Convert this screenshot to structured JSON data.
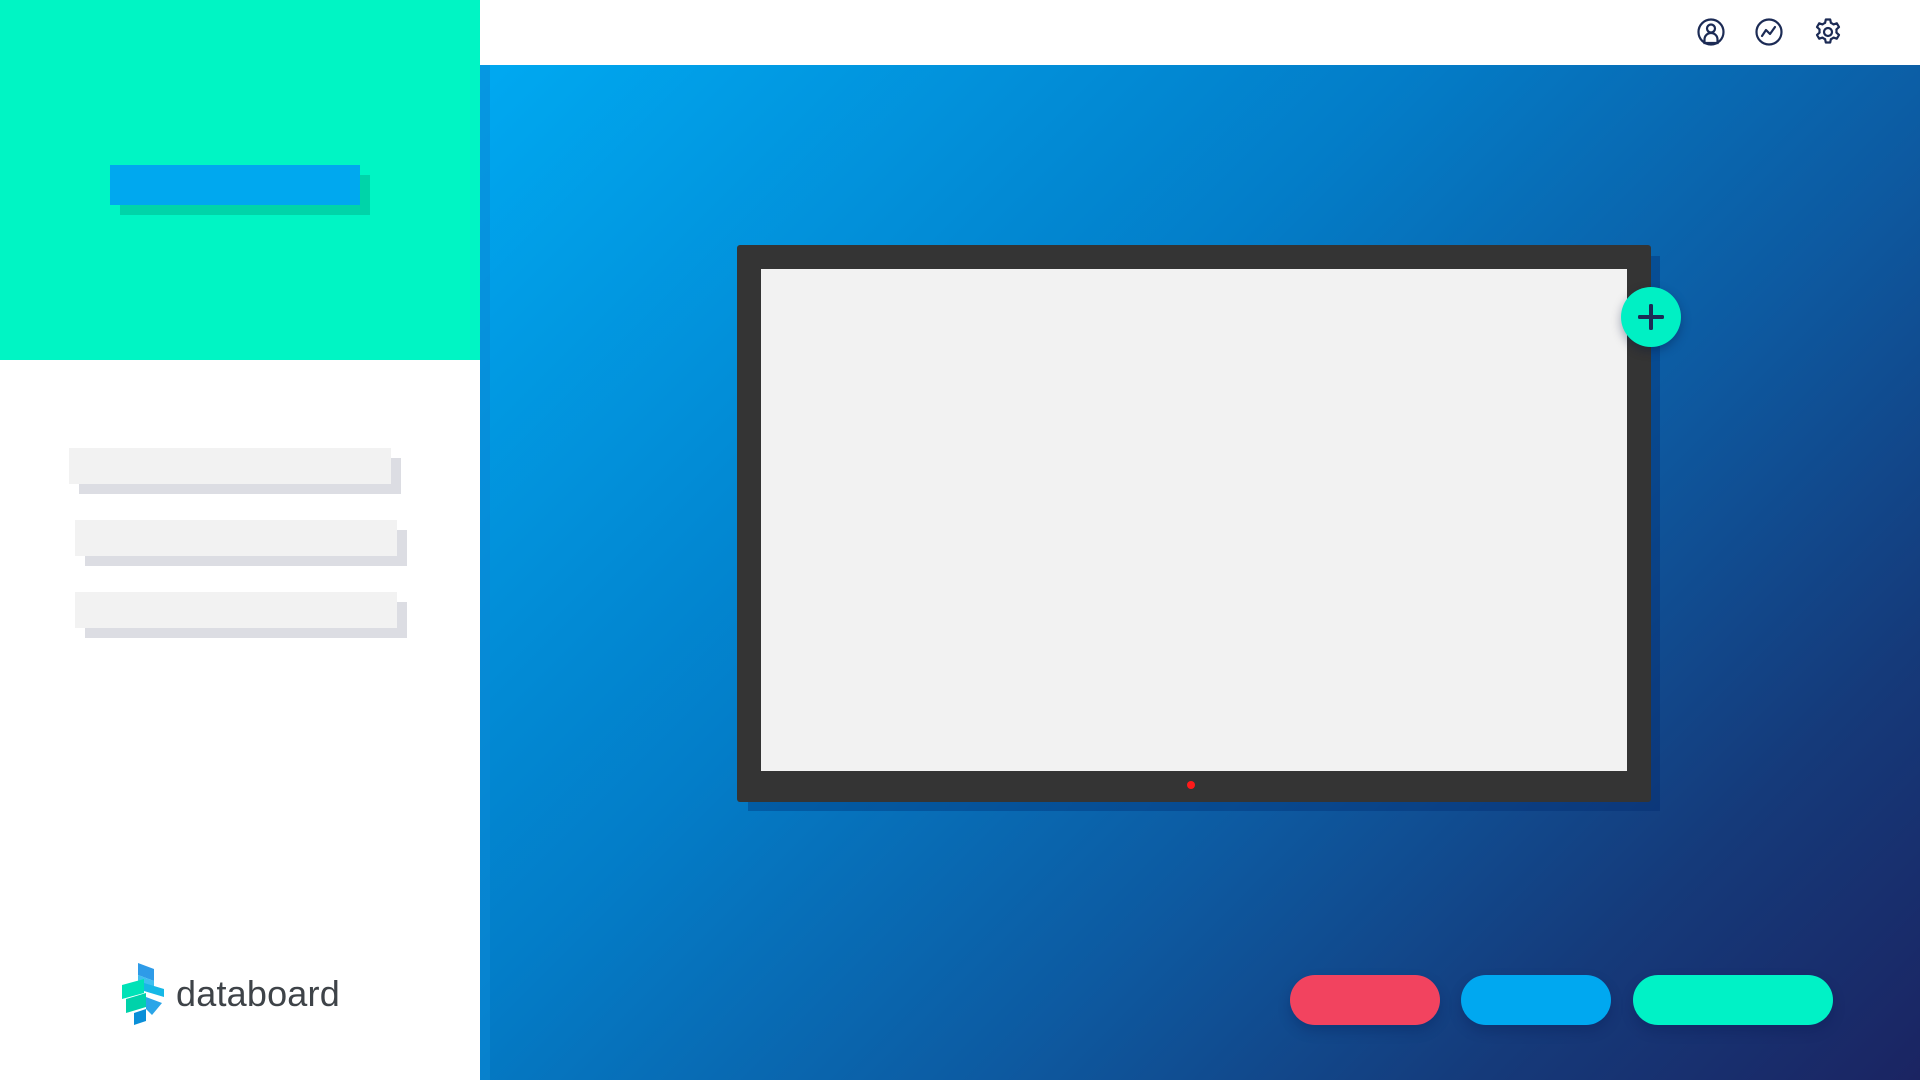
{
  "brand": {
    "name": "databoard"
  },
  "icons": {
    "topbar": [
      "user-icon",
      "analytics-icon",
      "gear-icon"
    ],
    "add": "plus-icon"
  },
  "colors": {
    "sidebar_accent": "#00f5c4",
    "primary_blue": "#00a8ef",
    "danger": "#f2435f",
    "success": "#00f2c6",
    "frame": "#343434",
    "indicator": "#ff1a1a",
    "icon_stroke": "#1c2b55"
  }
}
